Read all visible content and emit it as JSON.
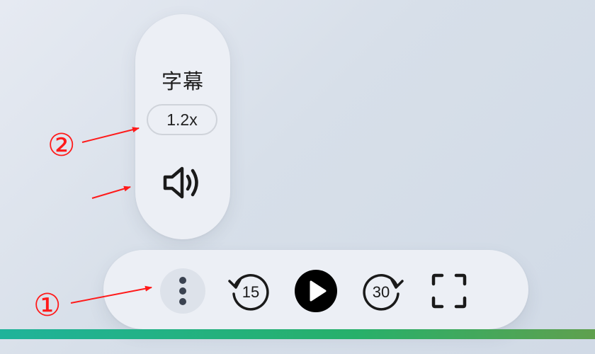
{
  "popup_menu": {
    "subtitle_label": "字幕",
    "speed_value": "1.2x",
    "volume_icon": "speaker-icon"
  },
  "controls": {
    "more_icon": "vertical-dots-icon",
    "rewind_seconds": "15",
    "play_icon": "play-icon",
    "forward_seconds": "30",
    "fullscreen_icon": "fullscreen-icon"
  },
  "progress": {
    "fraction": 1.0
  },
  "annotations": {
    "marker_1": "①",
    "marker_2": "②",
    "color": "#ff1a1a"
  },
  "colors": {
    "play_button": "#000000",
    "progress_start": "#1fb39a",
    "progress_end": "#5fa04e"
  }
}
